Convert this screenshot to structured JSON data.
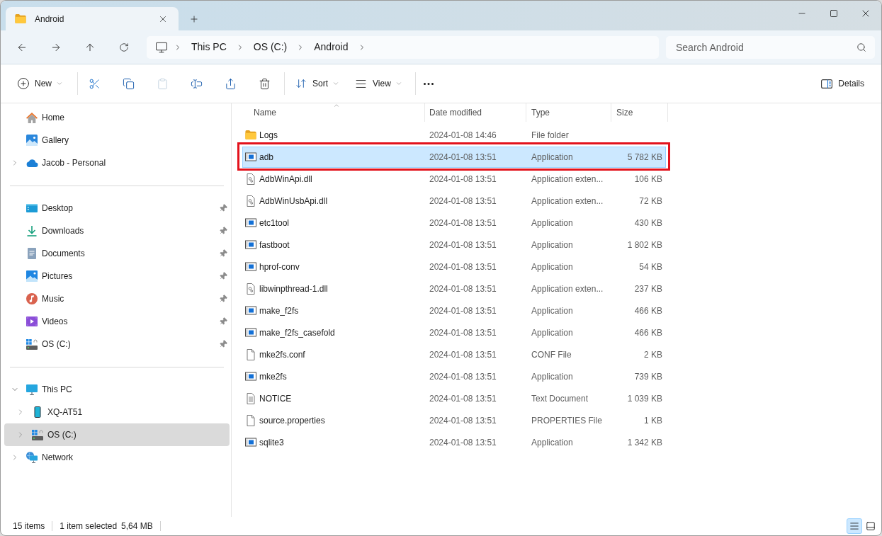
{
  "window": {
    "tabs": [
      {
        "title": "Android",
        "selected": true
      }
    ]
  },
  "address_bar": {
    "breadcrumbs": [
      "This PC",
      "OS (C:)",
      "Android"
    ]
  },
  "search": {
    "placeholder": "Search Android"
  },
  "toolbar": {
    "new": {
      "label": "New"
    },
    "actions": [
      {
        "disabled": false
      },
      {
        "disabled": false
      },
      {
        "disabled": true
      },
      {
        "disabled": false
      },
      {
        "disabled": false
      },
      {
        "disabled": false
      }
    ],
    "sort": {
      "label": "Sort"
    },
    "view": {
      "label": "View"
    },
    "details": {
      "label": "Details"
    }
  },
  "sidebar": {
    "groups": [
      {
        "items": [
          {
            "label": "Home",
            "kind": "home",
            "pinned": false,
            "selected": false
          },
          {
            "label": "Gallery",
            "kind": "gallery",
            "pinned": false,
            "selected": false
          },
          {
            "label": "Jacob - Personal",
            "kind": "cloud",
            "expanded": false,
            "pinned": false,
            "selected": false
          }
        ]
      },
      {
        "items": [
          {
            "label": "Desktop",
            "kind": "desktop",
            "pinned": true,
            "selected": false
          },
          {
            "label": "Downloads",
            "kind": "downloads",
            "pinned": true,
            "selected": false
          },
          {
            "label": "Documents",
            "kind": "documents",
            "pinned": true,
            "selected": false
          },
          {
            "label": "Pictures",
            "kind": "pictures",
            "pinned": true,
            "selected": false
          },
          {
            "label": "Music",
            "kind": "music",
            "pinned": true,
            "selected": false
          },
          {
            "label": "Videos",
            "kind": "videos",
            "pinned": true,
            "selected": false
          },
          {
            "label": "OS (C:)",
            "kind": "drive",
            "pinned": true,
            "selected": false
          }
        ]
      },
      {
        "items": [
          {
            "label": "This PC",
            "kind": "computer",
            "expanded": true,
            "pinned": false,
            "selected": false,
            "children": [
              {
                "label": "XQ-AT51",
                "kind": "phone",
                "expanded": false,
                "pinned": false,
                "selected": false
              },
              {
                "label": "OS (C:)",
                "kind": "drive",
                "expanded": false,
                "pinned": false,
                "selected": true
              }
            ]
          },
          {
            "label": "Network",
            "kind": "network",
            "expanded": false,
            "pinned": false,
            "selected": false
          }
        ]
      }
    ]
  },
  "table": {
    "columns": [
      {
        "label": "Name",
        "sorted": true
      },
      {
        "label": "Date modified",
        "sorted": false
      },
      {
        "label": "Type",
        "sorted": false
      },
      {
        "label": "Size",
        "sorted": false
      }
    ],
    "rows": [
      {
        "name": "Logs",
        "kind": "folder",
        "date_modified": "2024-01-08 14:46",
        "type": "File folder",
        "selected": false,
        "highlighted": false
      },
      {
        "name": "adb",
        "kind": "application",
        "date_modified": "2024-01-08 13:51",
        "type": "Application",
        "size": "5 782 KB",
        "selected": true,
        "highlighted": true
      },
      {
        "name": "AdbWinApi.dll",
        "kind": "extension",
        "date_modified": "2024-01-08 13:51",
        "type": "Application exten...",
        "size": "106 KB",
        "selected": false,
        "highlighted": false
      },
      {
        "name": "AdbWinUsbApi.dll",
        "kind": "extension",
        "date_modified": "2024-01-08 13:51",
        "type": "Application exten...",
        "size": "72 KB",
        "selected": false,
        "highlighted": false
      },
      {
        "name": "etc1tool",
        "kind": "application",
        "date_modified": "2024-01-08 13:51",
        "type": "Application",
        "size": "430 KB",
        "selected": false,
        "highlighted": false
      },
      {
        "name": "fastboot",
        "kind": "application",
        "date_modified": "2024-01-08 13:51",
        "type": "Application",
        "size": "1 802 KB",
        "selected": false,
        "highlighted": false
      },
      {
        "name": "hprof-conv",
        "kind": "application",
        "date_modified": "2024-01-08 13:51",
        "type": "Application",
        "size": "54 KB",
        "selected": false,
        "highlighted": false
      },
      {
        "name": "libwinpthread-1.dll",
        "kind": "extension",
        "date_modified": "2024-01-08 13:51",
        "type": "Application exten...",
        "size": "237 KB",
        "selected": false,
        "highlighted": false
      },
      {
        "name": "make_f2fs",
        "kind": "application",
        "date_modified": "2024-01-08 13:51",
        "type": "Application",
        "size": "466 KB",
        "selected": false,
        "highlighted": false
      },
      {
        "name": "make_f2fs_casefold",
        "kind": "application",
        "date_modified": "2024-01-08 13:51",
        "type": "Application",
        "size": "466 KB",
        "selected": false,
        "highlighted": false
      },
      {
        "name": "mke2fs.conf",
        "kind": "file",
        "date_modified": "2024-01-08 13:51",
        "type": "CONF File",
        "size": "2 KB",
        "selected": false,
        "highlighted": false
      },
      {
        "name": "mke2fs",
        "kind": "application",
        "date_modified": "2024-01-08 13:51",
        "type": "Application",
        "size": "739 KB",
        "selected": false,
        "highlighted": false
      },
      {
        "name": "NOTICE",
        "kind": "text",
        "date_modified": "2024-01-08 13:51",
        "type": "Text Document",
        "size": "1 039 KB",
        "selected": false,
        "highlighted": false
      },
      {
        "name": "source.properties",
        "kind": "file",
        "date_modified": "2024-01-08 13:51",
        "type": "PROPERTIES File",
        "size": "1 KB",
        "selected": false,
        "highlighted": false
      },
      {
        "name": "sqlite3",
        "kind": "application",
        "date_modified": "2024-01-08 13:51",
        "type": "Application",
        "size": "1 342 KB",
        "selected": false,
        "highlighted": false
      }
    ]
  },
  "status_bar": {
    "item_count": "15 items",
    "selection": "1 item selected",
    "selection_size": "5,64 MB",
    "layouts": [
      {
        "selected": true
      },
      {
        "selected": false
      }
    ]
  }
}
